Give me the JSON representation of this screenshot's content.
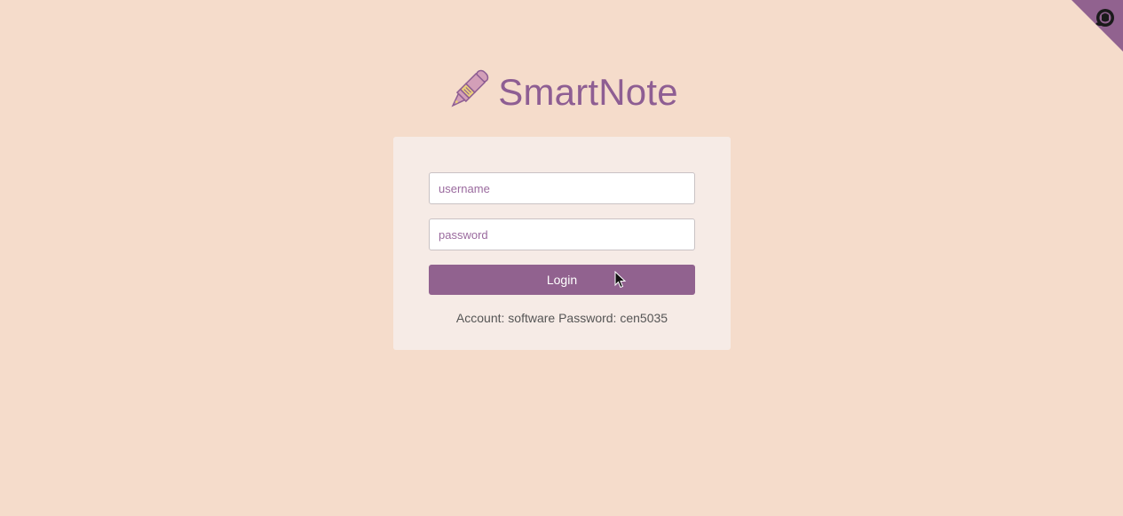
{
  "header": {
    "title": "SmartNote",
    "logo_icon": "fountain-pen-icon"
  },
  "login_form": {
    "username_placeholder": "username",
    "username_value": "",
    "password_placeholder": "password",
    "password_value": "",
    "login_label": "Login",
    "hint": "Account: software Password: cen5035"
  },
  "corner_ribbon": {
    "icon": "github-icon"
  },
  "colors": {
    "background": "#f5dccb",
    "card": "#f6ebe6",
    "accent": "#91628f",
    "title": "#8e5e93"
  }
}
